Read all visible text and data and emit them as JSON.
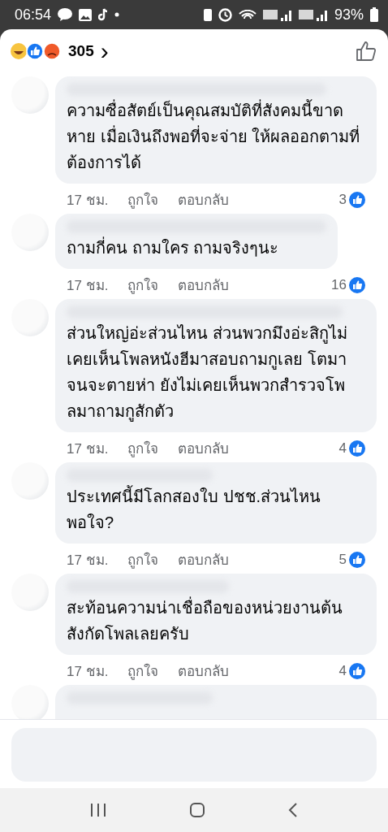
{
  "status_bar": {
    "time": "06:54",
    "battery": "93%"
  },
  "reactions": {
    "count": "305",
    "chevron": "›"
  },
  "comments": [
    {
      "kind": "full",
      "text": "ความซื่อสัตย์เป็นคุณสมบัติที่สังคมนี้ขาดหาย เมื่อเงินถึงพอที่จะจ่าย ให้ผลออกตามที่ต้องการได้",
      "time": "17 ชม.",
      "like": "ถูกใจ",
      "reply": "ตอบกลับ",
      "likes": "3"
    },
    {
      "kind": "full",
      "text": "ถามกี่คน  ถามใคร ถามจริงๆนะ",
      "time": "17 ชม.",
      "like": "ถูกใจ",
      "reply": "ตอบกลับ",
      "likes": "16"
    },
    {
      "kind": "full",
      "text": "ส่วนใหญ่อ่ะส่วนไหน ส่วนพวกมึงอ่ะสิกูไม่เคยเห็นโพลหนังฮีมาสอบถามกูเลย โตมาจนจะตายห่า ยังไม่เคยเห็นพวกสำรวจโพลมาถามกูสักตัว",
      "time": "17 ชม.",
      "like": "ถูกใจ",
      "reply": "ตอบกลับ",
      "likes": "4"
    },
    {
      "kind": "full",
      "text": "ประเทศนี้มีโลกสองใบ ปชช.ส่วนไหนพอใจ?",
      "time": "17 ชม.",
      "like": "ถูกใจ",
      "reply": "ตอบกลับ",
      "likes": "5"
    },
    {
      "kind": "full",
      "text": "สะท้อนความน่าเชื่อถือของหน่วยงานต้นสังกัดโพลเลยครับ",
      "time": "17 ชม.",
      "like": "ถูกใจ",
      "reply": "ตอบกลับ",
      "likes": "4"
    },
    {
      "kind": "partial"
    }
  ]
}
